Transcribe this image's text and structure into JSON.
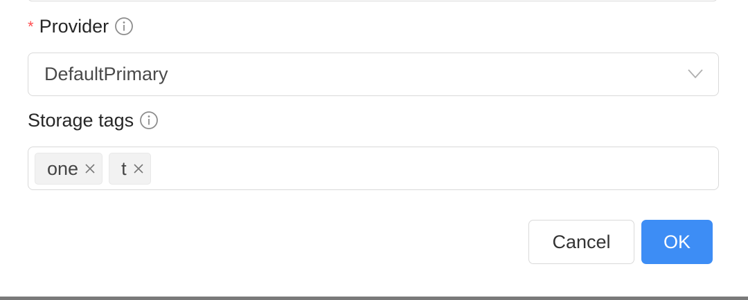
{
  "form": {
    "provider": {
      "required_mark": "*",
      "label": "Provider",
      "value": "DefaultPrimary"
    },
    "storage_tags": {
      "label": "Storage tags",
      "tags": [
        "one",
        "t"
      ]
    }
  },
  "actions": {
    "cancel_label": "Cancel",
    "ok_label": "OK"
  },
  "colors": {
    "primary": "#3d8df5",
    "required": "#ff4d4f",
    "border": "#d9d9d9",
    "tag_bg": "#f2f2f2"
  },
  "icons": [
    "info-icon",
    "chevron-down-icon",
    "close-icon"
  ]
}
